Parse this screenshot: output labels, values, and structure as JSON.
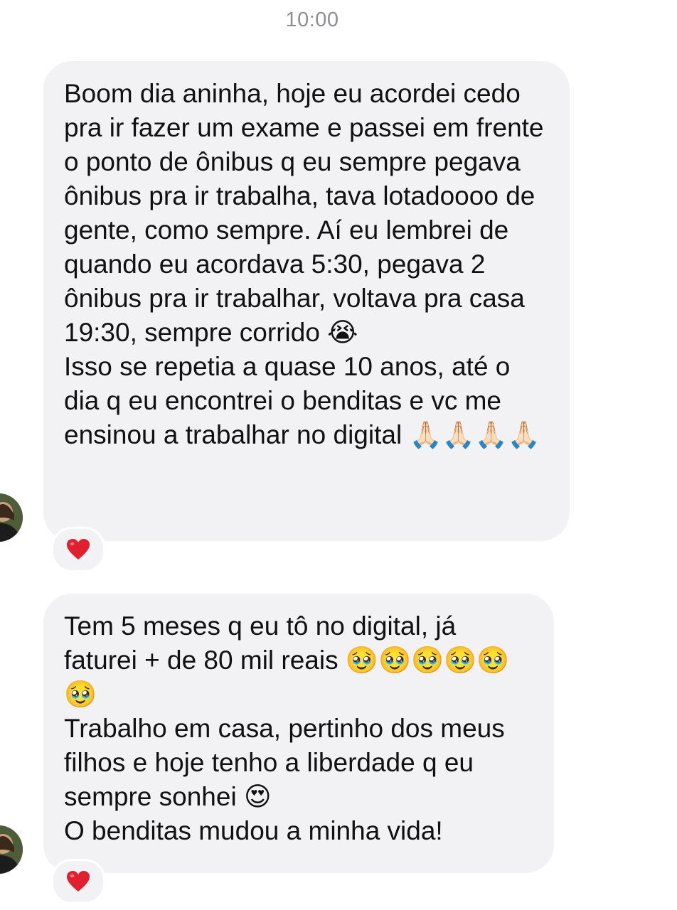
{
  "header": {
    "time": "10:00"
  },
  "messages": [
    {
      "paragraphs": [
        "Boom dia aninha, hoje eu acordei cedo pra ir fazer um exame e passei em frente o ponto de ônibus q eu sempre pegava ônibus pra ir trabalha, tava lotadoooo de gente, como sempre. Aí eu lembrei de quando eu acordava 5:30, pegava 2 ônibus pra ir trabalhar, voltava pra casa 19:30, sempre corrido 😭",
        "Isso se repetia a quase 10 anos, até o dia q eu encontrei o benditas e vc me ensinou a trabalhar no digital 🙏🏻🙏🏻🙏🏻🙏🏻"
      ],
      "reaction": "heart"
    },
    {
      "paragraphs": [
        "Tem 5 meses q eu tô no digital, já faturei + de 80 mil reais 🥹🥹🥹🥹🥹🥹",
        "Trabalho em casa, pertinho dos meus filhos e hoje tenho a liberdade q eu sempre sonhei 😍",
        "O benditas mudou a minha vida!"
      ],
      "reaction": "heart"
    }
  ],
  "colors": {
    "bubble_background": "#f2f2f4",
    "timestamp_text": "#8e8e93",
    "heart": "#e0202e"
  }
}
